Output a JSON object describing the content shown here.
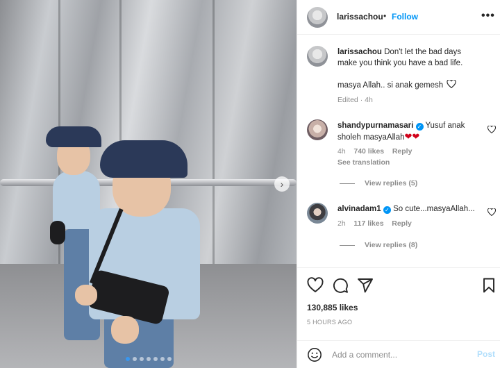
{
  "post": {
    "username": "larissachou",
    "separator": "•",
    "follow_label": "Follow",
    "more_icon": "more-horizontal-icon",
    "more_glyph": "•••",
    "carousel": {
      "image_count": 7,
      "active_index": 0,
      "next_icon": "chevron-right-icon",
      "next_glyph": "›"
    }
  },
  "caption": {
    "username": "larissachou",
    "text_line1": "Don't let the bad days",
    "text_line2": "make you think you have a bad life.",
    "text_line3": "masya Allah.. si anak gemesh",
    "meta": "Edited · 4h"
  },
  "comments": [
    {
      "username": "shandypurnamasari",
      "verified": true,
      "text_part1": "Yusuf anak",
      "text_part2": "sholeh masyaAllah",
      "hearts": "❤❤",
      "time": "4h",
      "likes": "740 likes",
      "reply_label": "Reply",
      "see_translation": "See translation",
      "view_replies": "View replies (5)"
    },
    {
      "username": "alvinadam1",
      "verified": true,
      "text": "So cute...masyaAllah...",
      "time": "2h",
      "likes": "117 likes",
      "reply_label": "Reply",
      "view_replies": "View replies (8)"
    }
  ],
  "actions": {
    "likes": "130,885 likes",
    "posted_ago": "5 HOURS AGO"
  },
  "compose": {
    "placeholder": "Add a comment...",
    "post_label": "Post"
  },
  "colors": {
    "accent_blue": "#0095f6",
    "post_disabled": "#b2dffc",
    "secondary_text": "#8e8e8e",
    "heart_red": "#d0021b"
  }
}
